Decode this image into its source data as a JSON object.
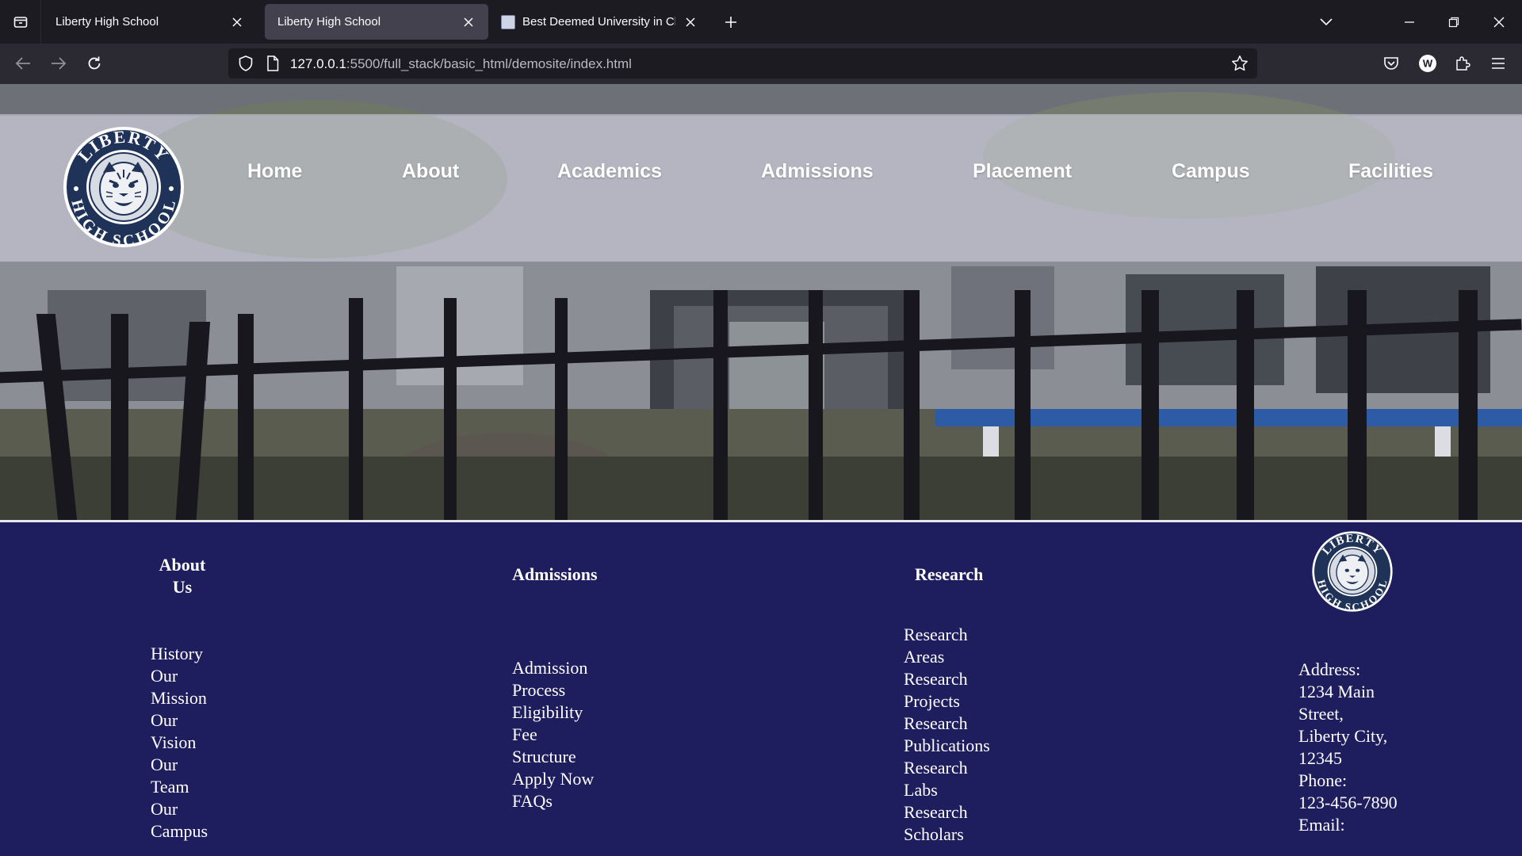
{
  "browser": {
    "tabs": [
      {
        "title": "Liberty High School",
        "active": false
      },
      {
        "title": "Liberty High School",
        "active": true
      },
      {
        "title": "Best Deemed University in Chen",
        "active": false
      }
    ],
    "url_host": "127.0.0.1",
    "url_path": ":5500/full_stack/basic_html/demosite/index.html"
  },
  "header": {
    "logo_text_top": "LIBERTY",
    "logo_text_bottom": "HIGH SCHOOL",
    "menu": [
      "Home",
      "About",
      "Academics",
      "Admissions",
      "Placement",
      "Campus",
      "Facilities"
    ]
  },
  "footer": {
    "about": {
      "heading_line1": "About",
      "heading_line2": "Us",
      "links": [
        "History",
        "Our",
        "Mission",
        "Our",
        "Vision",
        "Our",
        "Team",
        "Our",
        "Campus"
      ]
    },
    "admissions": {
      "heading": "Admissions",
      "links": [
        "Admission",
        "Process",
        "Eligibility",
        "Fee",
        "Structure",
        "Apply Now",
        "FAQs"
      ]
    },
    "research": {
      "heading": "Research",
      "links": [
        "Research",
        "Areas",
        "Research",
        "Projects",
        "Research",
        "Publications",
        "Research",
        "Labs",
        "Research",
        "Scholars"
      ]
    },
    "contact": {
      "lines": [
        "Address:",
        "1234 Main",
        "Street,",
        "Liberty City,",
        "12345",
        "Phone:",
        "123-456-7890",
        "Email:"
      ]
    }
  },
  "colors": {
    "footer_bg": "#1e1d5e",
    "logo_navy": "#1f3258",
    "header_band": "rgba(214,214,228,0.55)"
  }
}
